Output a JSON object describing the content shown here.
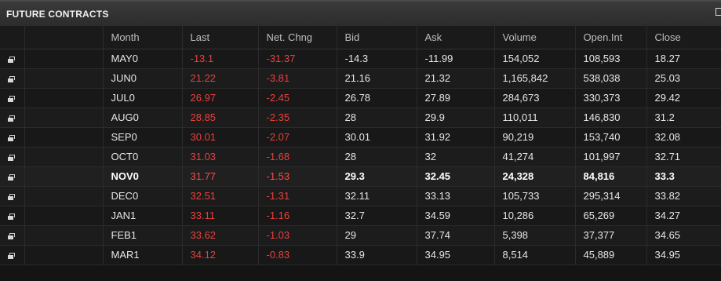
{
  "panel": {
    "title": "FUTURE CONTRACTS",
    "corner_icon": "popout-icon"
  },
  "columns": [
    "Month",
    "Last",
    "Net. Chng",
    "Bid",
    "Ask",
    "Volume",
    "Open.Int",
    "Close"
  ],
  "rows": [
    {
      "month": "MAY0",
      "last": "-13.1",
      "net": "-31.37",
      "bid": "-14.3",
      "ask": "-11.99",
      "volume": "154,052",
      "oi": "108,593",
      "close": "18.27"
    },
    {
      "month": "JUN0",
      "last": "21.22",
      "net": "-3.81",
      "bid": "21.16",
      "ask": "21.32",
      "volume": "1,165,842",
      "oi": "538,038",
      "close": "25.03"
    },
    {
      "month": "JUL0",
      "last": "26.97",
      "net": "-2.45",
      "bid": "26.78",
      "ask": "27.89",
      "volume": "284,673",
      "oi": "330,373",
      "close": "29.42"
    },
    {
      "month": "AUG0",
      "last": "28.85",
      "net": "-2.35",
      "bid": "28",
      "ask": "29.9",
      "volume": "110,011",
      "oi": "146,830",
      "close": "31.2"
    },
    {
      "month": "SEP0",
      "last": "30.01",
      "net": "-2.07",
      "bid": "30.01",
      "ask": "31.92",
      "volume": "90,219",
      "oi": "153,740",
      "close": "32.08"
    },
    {
      "month": "OCT0",
      "last": "31.03",
      "net": "-1.68",
      "bid": "28",
      "ask": "32",
      "volume": "41,274",
      "oi": "101,997",
      "close": "32.71"
    },
    {
      "month": "NOV0",
      "last": "31.77",
      "net": "-1.53",
      "bid": "29.3",
      "ask": "32.45",
      "volume": "24,328",
      "oi": "84,816",
      "close": "33.3"
    },
    {
      "month": "DEC0",
      "last": "32.51",
      "net": "-1.31",
      "bid": "32.11",
      "ask": "33.13",
      "volume": "105,733",
      "oi": "295,314",
      "close": "33.82"
    },
    {
      "month": "JAN1",
      "last": "33.11",
      "net": "-1.16",
      "bid": "32.7",
      "ask": "34.59",
      "volume": "10,286",
      "oi": "65,269",
      "close": "34.27"
    },
    {
      "month": "FEB1",
      "last": "33.62",
      "net": "-1.03",
      "bid": "29",
      "ask": "37.74",
      "volume": "5,398",
      "oi": "37,377",
      "close": "34.65"
    },
    {
      "month": "MAR1",
      "last": "34.12",
      "net": "-0.83",
      "bid": "33.9",
      "ask": "34.95",
      "volume": "8,514",
      "oi": "45,889",
      "close": "34.95"
    }
  ],
  "active_row_month": "NOV0",
  "row_icon": "popout-window-icon",
  "colors": {
    "background": "#141414",
    "header_bar": "#2c2c2c",
    "negative_red": "#e8413c",
    "text": "#e6e6e6"
  }
}
